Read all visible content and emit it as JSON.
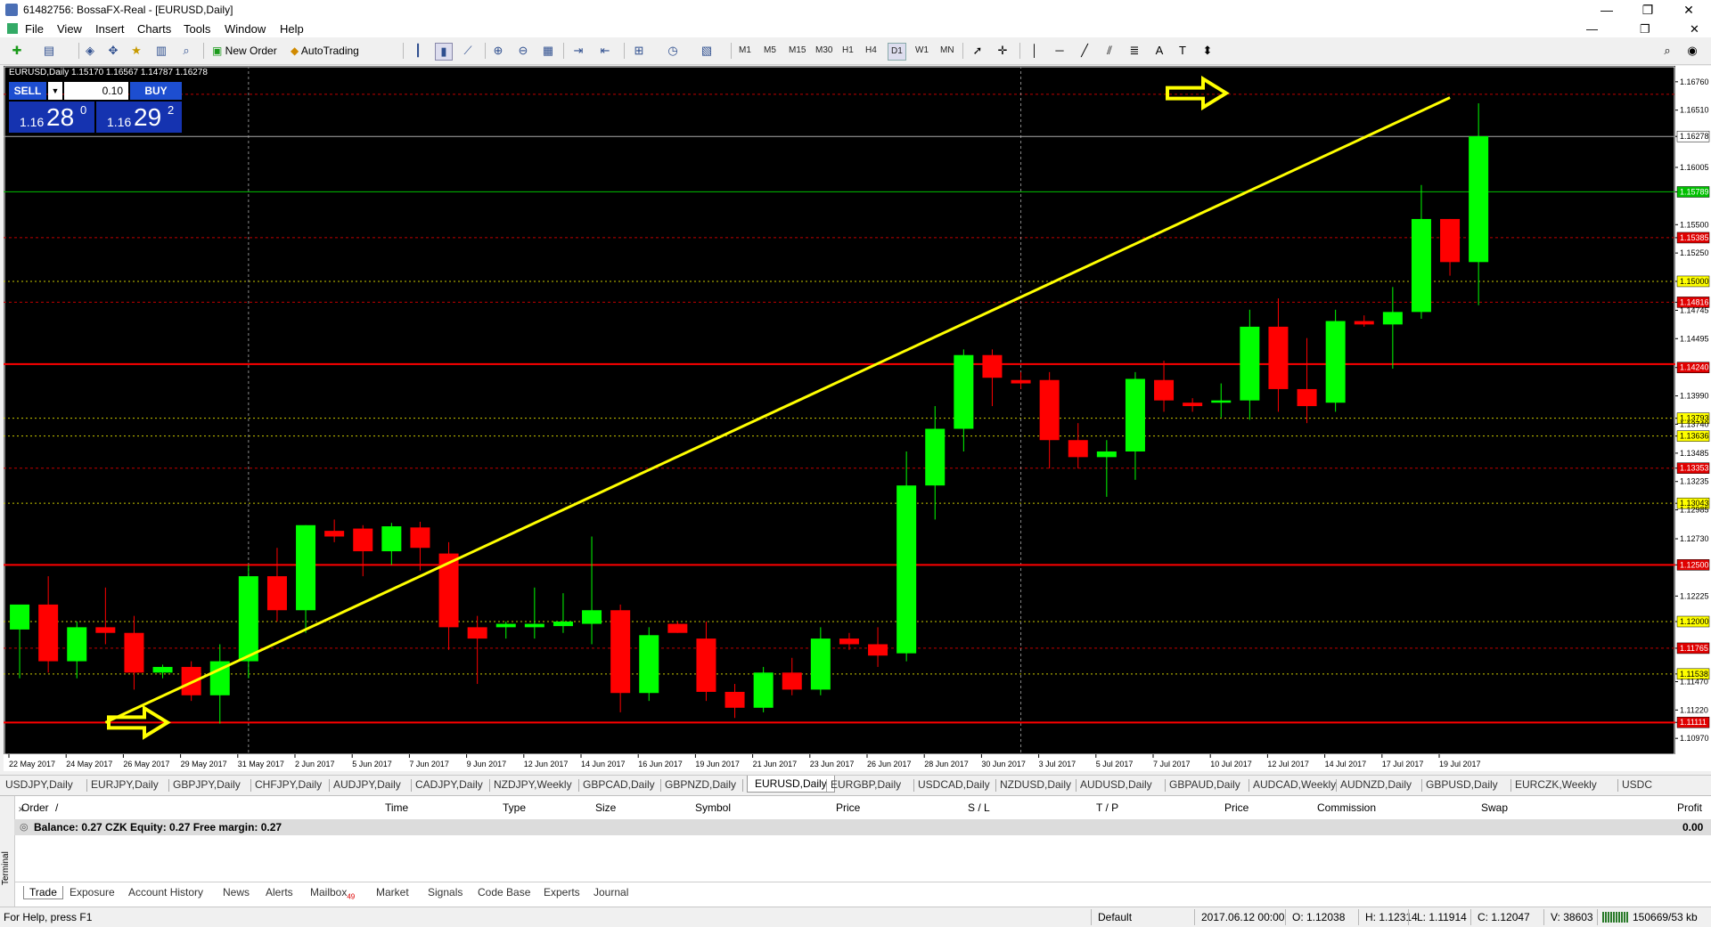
{
  "window": {
    "title": "61482756: BossaFX-Real - [EURUSD,Daily]",
    "controls": [
      "—",
      "❐",
      "✕"
    ]
  },
  "menu": [
    "File",
    "View",
    "Insert",
    "Charts",
    "Tools",
    "Window",
    "Help"
  ],
  "toolbar": {
    "new_order": "New Order",
    "autotrading": "AutoTrading",
    "timeframes": [
      "M1",
      "M5",
      "M15",
      "M30",
      "H1",
      "H4",
      "D1",
      "W1",
      "MN"
    ],
    "active_timeframe": "D1"
  },
  "chart": {
    "info": "EURUSD,Daily  1.15170 1.16567 1.14787 1.16278",
    "one_click": {
      "sell_label": "SELL",
      "buy_label": "BUY",
      "lot": "0.10",
      "sell_small": "1.16",
      "sell_big": "28",
      "sell_sup": "0",
      "buy_small": "1.16",
      "buy_big": "29",
      "buy_sup": "2"
    },
    "colors": {
      "background": "#000000",
      "bull": "#00ff00",
      "bear": "#ff0000",
      "trendline": "#ffff00",
      "level": "#ff0000"
    },
    "y_range": [
      1.1083,
      1.169
    ],
    "price_ticks": [
      "1.16760",
      "1.16510",
      "1.16278",
      "1.16005",
      "1.15789",
      "1.15500",
      "1.15385",
      "1.15250",
      "1.15000",
      "1.14816",
      "1.14745",
      "1.14495",
      "1.14240",
      "1.13990",
      "1.13793",
      "1.13740",
      "1.13636",
      "1.13485",
      "1.13353",
      "1.13235",
      "1.13043",
      "1.12985",
      "1.12730",
      "1.12500",
      "1.12225",
      "1.12000",
      "1.11765",
      "1.11538",
      "1.11470",
      "1.11220",
      "1.11111",
      "1.10970"
    ],
    "date_labels": [
      "22 May 2017",
      "24 May 2017",
      "26 May 2017",
      "29 May 2017",
      "31 May 2017",
      "2 Jun 2017",
      "5 Jun 2017",
      "7 Jun 2017",
      "9 Jun 2017",
      "12 Jun 2017",
      "14 Jun 2017",
      "16 Jun 2017",
      "19 Jun 2017",
      "21 Jun 2017",
      "23 Jun 2017",
      "26 Jun 2017",
      "28 Jun 2017",
      "30 Jun 2017",
      "3 Jul 2017",
      "5 Jul 2017",
      "7 Jul 2017",
      "10 Jul 2017",
      "12 Jul 2017",
      "14 Jul 2017",
      "17 Jul 2017",
      "19 Jul 2017"
    ],
    "candles": [
      {
        "o": 1.1193,
        "h": 1.1205,
        "l": 1.115,
        "c": 1.1215
      },
      {
        "o": 1.1215,
        "h": 1.124,
        "l": 1.1155,
        "c": 1.1165
      },
      {
        "o": 1.1165,
        "h": 1.12,
        "l": 1.115,
        "c": 1.1195
      },
      {
        "o": 1.1195,
        "h": 1.123,
        "l": 1.118,
        "c": 1.119
      },
      {
        "o": 1.119,
        "h": 1.1205,
        "l": 1.114,
        "c": 1.1155
      },
      {
        "o": 1.1155,
        "h": 1.1162,
        "l": 1.115,
        "c": 1.116
      },
      {
        "o": 1.116,
        "h": 1.1165,
        "l": 1.113,
        "c": 1.1135
      },
      {
        "o": 1.1135,
        "h": 1.118,
        "l": 1.111,
        "c": 1.1165
      },
      {
        "o": 1.1165,
        "h": 1.125,
        "l": 1.115,
        "c": 1.124
      },
      {
        "o": 1.124,
        "h": 1.1265,
        "l": 1.12,
        "c": 1.121
      },
      {
        "o": 1.121,
        "h": 1.1285,
        "l": 1.119,
        "c": 1.1285
      },
      {
        "o": 1.128,
        "h": 1.129,
        "l": 1.127,
        "c": 1.1275
      },
      {
        "o": 1.1282,
        "h": 1.1285,
        "l": 1.124,
        "c": 1.1262
      },
      {
        "o": 1.1262,
        "h": 1.1287,
        "l": 1.125,
        "c": 1.1284
      },
      {
        "o": 1.1283,
        "h": 1.1288,
        "l": 1.1245,
        "c": 1.1265
      },
      {
        "o": 1.126,
        "h": 1.127,
        "l": 1.1175,
        "c": 1.1195
      },
      {
        "o": 1.1195,
        "h": 1.1205,
        "l": 1.1145,
        "c": 1.1185
      },
      {
        "o": 1.1195,
        "h": 1.12,
        "l": 1.1185,
        "c": 1.1198
      },
      {
        "o": 1.1195,
        "h": 1.123,
        "l": 1.1185,
        "c": 1.1198
      },
      {
        "o": 1.1196,
        "h": 1.1225,
        "l": 1.119,
        "c": 1.12
      },
      {
        "o": 1.1198,
        "h": 1.1275,
        "l": 1.118,
        "c": 1.121
      },
      {
        "o": 1.121,
        "h": 1.1215,
        "l": 1.112,
        "c": 1.1137
      },
      {
        "o": 1.1137,
        "h": 1.1195,
        "l": 1.113,
        "c": 1.1188
      },
      {
        "o": 1.1198,
        "h": 1.12,
        "l": 1.119,
        "c": 1.119
      },
      {
        "o": 1.1185,
        "h": 1.12,
        "l": 1.113,
        "c": 1.1138
      },
      {
        "o": 1.1138,
        "h": 1.1145,
        "l": 1.1115,
        "c": 1.1124
      },
      {
        "o": 1.1124,
        "h": 1.116,
        "l": 1.112,
        "c": 1.1155
      },
      {
        "o": 1.1155,
        "h": 1.1168,
        "l": 1.1135,
        "c": 1.114
      },
      {
        "o": 1.114,
        "h": 1.1195,
        "l": 1.1135,
        "c": 1.1185
      },
      {
        "o": 1.1185,
        "h": 1.119,
        "l": 1.1175,
        "c": 1.118
      },
      {
        "o": 1.118,
        "h": 1.1195,
        "l": 1.116,
        "c": 1.117
      },
      {
        "o": 1.1172,
        "h": 1.135,
        "l": 1.1165,
        "c": 1.132
      },
      {
        "o": 1.132,
        "h": 1.139,
        "l": 1.129,
        "c": 1.137
      },
      {
        "o": 1.137,
        "h": 1.144,
        "l": 1.135,
        "c": 1.1435
      },
      {
        "o": 1.1435,
        "h": 1.144,
        "l": 1.139,
        "c": 1.1415
      },
      {
        "o": 1.1413,
        "h": 1.142,
        "l": 1.1405,
        "c": 1.141
      },
      {
        "o": 1.1413,
        "h": 1.142,
        "l": 1.1335,
        "c": 1.136
      },
      {
        "o": 1.136,
        "h": 1.1375,
        "l": 1.1335,
        "c": 1.1345
      },
      {
        "o": 1.1345,
        "h": 1.136,
        "l": 1.131,
        "c": 1.135
      },
      {
        "o": 1.135,
        "h": 1.142,
        "l": 1.1325,
        "c": 1.1414
      },
      {
        "o": 1.1413,
        "h": 1.143,
        "l": 1.1385,
        "c": 1.1395
      },
      {
        "o": 1.1393,
        "h": 1.1397,
        "l": 1.1385,
        "c": 1.139
      },
      {
        "o": 1.1393,
        "h": 1.141,
        "l": 1.138,
        "c": 1.1395
      },
      {
        "o": 1.1395,
        "h": 1.1475,
        "l": 1.1378,
        "c": 1.146
      },
      {
        "o": 1.146,
        "h": 1.1485,
        "l": 1.1385,
        "c": 1.1405
      },
      {
        "o": 1.1405,
        "h": 1.145,
        "l": 1.1375,
        "c": 1.139
      },
      {
        "o": 1.1393,
        "h": 1.1475,
        "l": 1.1385,
        "c": 1.1465
      },
      {
        "o": 1.1465,
        "h": 1.147,
        "l": 1.146,
        "c": 1.1462
      },
      {
        "o": 1.1462,
        "h": 1.1495,
        "l": 1.1423,
        "c": 1.1473
      },
      {
        "o": 1.1473,
        "h": 1.1585,
        "l": 1.1467,
        "c": 1.1555
      },
      {
        "o": 1.1555,
        "h": 1.1555,
        "l": 1.1505,
        "c": 1.1517
      },
      {
        "o": 1.1517,
        "h": 1.1657,
        "l": 1.1479,
        "c": 1.1628
      }
    ],
    "red_levels": [
      1.1427,
      1.125,
      1.1111
    ],
    "green_level": 1.1579,
    "trendline": {
      "from": [
        3,
        1.1111
      ],
      "to": [
        50,
        1.1662
      ]
    }
  },
  "chart_tabs": [
    "USDJPY,Daily",
    "EURJPY,Daily",
    "GBPJPY,Daily",
    "CHFJPY,Daily",
    "AUDJPY,Daily",
    "CADJPY,Daily",
    "NZDJPY,Weekly",
    "GBPCAD,Daily",
    "GBPNZD,Daily",
    "EURUSD,Daily",
    "EURGBP,Daily",
    "USDCAD,Daily",
    "NZDUSD,Daily",
    "AUDUSD,Daily",
    "GBPAUD,Daily",
    "AUDCAD,Weekly",
    "AUDNZD,Daily",
    "GBPUSD,Daily",
    "EURCZK,Weekly",
    "USDC"
  ],
  "active_chart_tab": "EURUSD,Daily",
  "terminal": {
    "side_label": "Terminal",
    "columns": [
      "Order",
      "/",
      "Time",
      "Type",
      "Size",
      "Symbol",
      "Price",
      "S / L",
      "T / P",
      "Price",
      "Commission",
      "Swap",
      "Profit"
    ],
    "balance_text": "Balance: 0.27 CZK  Equity: 0.27  Free margin: 0.27",
    "profit_total": "0.00",
    "tabs": [
      "Trade",
      "Exposure",
      "Account History",
      "News",
      "Alerts",
      "Mailbox",
      "Market",
      "Signals",
      "Code Base",
      "Experts",
      "Journal"
    ],
    "mailbox_count": "49"
  },
  "status": {
    "help": "For Help, press F1",
    "profile": "Default",
    "datetime": "2017.06.12 00:00",
    "open": "O: 1.12038",
    "high": "H: 1.12314",
    "low": "L: 1.11914",
    "close": "C: 1.12047",
    "volume": "V: 38603",
    "traffic": "150669/53 kb"
  }
}
